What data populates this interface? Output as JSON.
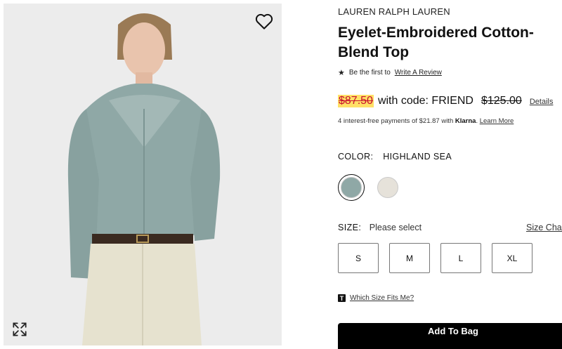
{
  "product": {
    "brand": "LAUREN RALPH LAUREN",
    "title": "Eyelet-Embroidered Cotton-Blend Top",
    "review_prompt": "Be the first to",
    "review_link": "Write A Review",
    "image_alt": "Model wearing the Eyelet-Embroidered Cotton-Blend Top"
  },
  "pricing": {
    "sale_price": "$87.50",
    "code_text": "with code: FRIEND",
    "original_price": "$125.00",
    "details_link": "Details",
    "installments_prefix": "4 interest-free payments of $21.87 with",
    "installments_provider": "Klarna",
    "installments_suffix": ".",
    "learn_more": "Learn More"
  },
  "color": {
    "label": "COLOR:",
    "selected": "HIGHLAND SEA",
    "swatches": [
      {
        "name": "Highland Sea",
        "hex": "#8fa8a6",
        "selected": true
      },
      {
        "name": "Cream",
        "hex": "#e6e2da",
        "selected": false
      }
    ]
  },
  "size": {
    "label": "SIZE:",
    "prompt": "Please select",
    "chart_link": "Size Chart",
    "options": [
      "S",
      "M",
      "L",
      "XL"
    ]
  },
  "fit": {
    "icon": "T",
    "link": "Which Size Fits Me?"
  },
  "actions": {
    "add_to_bag": "Add To Bag"
  },
  "icons": {
    "wishlist": "heart-outline-icon",
    "expand": "expand-arrows-icon",
    "star": "star-icon"
  },
  "colors": {
    "sale_highlight": "#ffe066",
    "sale_text": "#c8102e",
    "button_bg": "#000000"
  }
}
